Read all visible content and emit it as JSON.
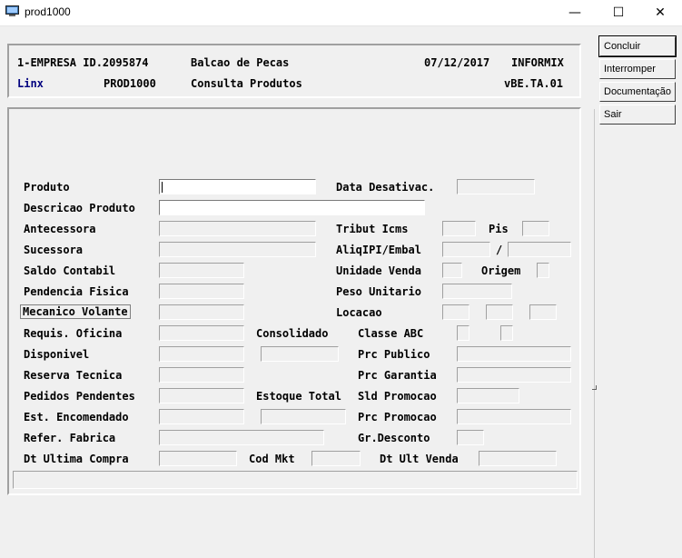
{
  "window": {
    "title": "prod1000",
    "minimize": "—",
    "maximize": "☐",
    "close": "✕"
  },
  "side_buttons": [
    "Concluir",
    "Interromper",
    "Documentação",
    "Sair"
  ],
  "header": {
    "company": "1-EMPRESA ID.2095874",
    "module": "Balcao de Pecas",
    "date": "07/12/2017",
    "db": "INFORMIX",
    "brand": "Linx",
    "program": "PROD1000",
    "screen": "Consulta Produtos",
    "version": "vBE.TA.01"
  },
  "labels": {
    "produto": "Produto",
    "data_desativac": "Data Desativac.",
    "descricao_produto": "Descricao Produto",
    "antecessora": "Antecessora",
    "tribut_icms": "Tribut Icms",
    "pis": "Pis",
    "sucessora": "Sucessora",
    "aliqipi_embal": "AliqIPI/Embal",
    "slash": "/",
    "saldo_contabil": "Saldo Contabil",
    "unidade_venda": "Unidade Venda",
    "origem": "Origem",
    "pendencia_fisica": "Pendencia Fisica",
    "peso_unitario": "Peso Unitario",
    "mecanico_volante": "Mecanico Volante",
    "locacao": "Locacao",
    "requis_oficina": "Requis. Oficina",
    "consolidado": "Consolidado",
    "classe_abc": "Classe ABC",
    "disponivel": "Disponivel",
    "prc_publico": "Prc Publico",
    "reserva_tecnica": "Reserva Tecnica",
    "prc_garantia": "Prc Garantia",
    "pedidos_pendentes": "Pedidos Pendentes",
    "estoque_total": "Estoque Total",
    "sld_promocao": "Sld Promocao",
    "est_encomendado": "Est. Encomendado",
    "prc_promocao": "Prc Promocao",
    "refer_fabrica": "Refer. Fabrica",
    "gr_desconto": "Gr.Desconto",
    "dt_ultima_compra": "Dt Ultima Compra",
    "cod_mkt": "Cod Mkt",
    "dt_ult_venda": "Dt Ult Venda"
  }
}
